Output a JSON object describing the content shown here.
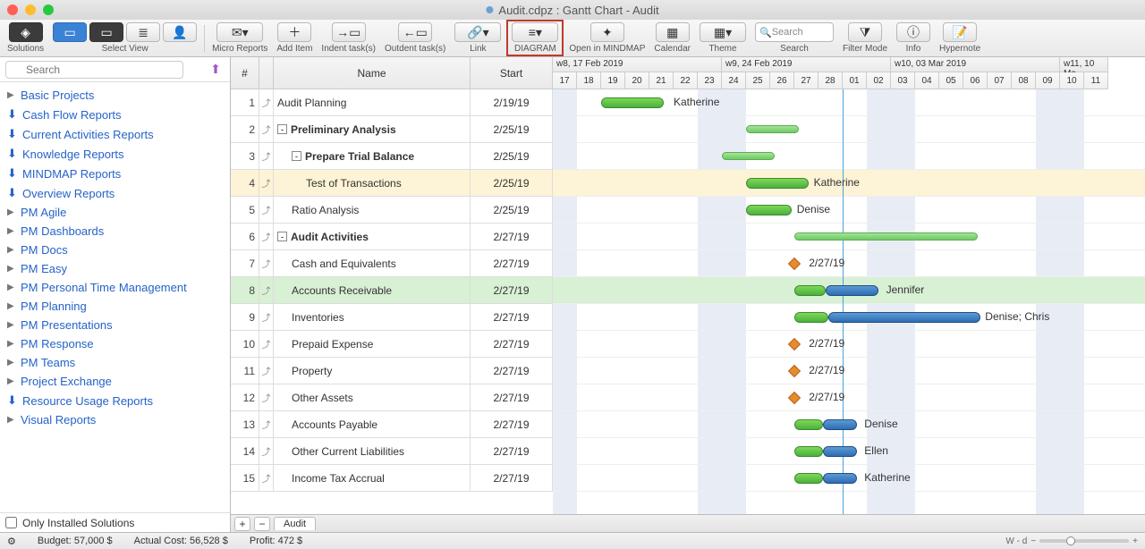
{
  "window": {
    "title": "Audit.cdpz : Gantt Chart - Audit"
  },
  "toolbar": {
    "solutions": "Solutions",
    "select_view": "Select View",
    "micro_reports": "Micro Reports",
    "add_item": "Add Item",
    "indent": "Indent task(s)",
    "outdent": "Outdent task(s)",
    "link": "Link",
    "diagram": "DIAGRAM",
    "open_mindmap": "Open in MINDMAP",
    "calendar": "Calendar",
    "theme": "Theme",
    "search": "Search",
    "search_placeholder": "Search",
    "filter_mode": "Filter Mode",
    "info": "Info",
    "hypernote": "Hypernote"
  },
  "sidebar": {
    "search_placeholder": "Search",
    "items": [
      {
        "icon": "tri",
        "label": "Basic Projects"
      },
      {
        "icon": "dl",
        "label": "Cash Flow Reports"
      },
      {
        "icon": "dl",
        "label": "Current Activities Reports"
      },
      {
        "icon": "dl",
        "label": "Knowledge Reports"
      },
      {
        "icon": "dl",
        "label": "MINDMAP Reports"
      },
      {
        "icon": "dl",
        "label": "Overview Reports"
      },
      {
        "icon": "tri",
        "label": "PM Agile"
      },
      {
        "icon": "tri",
        "label": "PM Dashboards"
      },
      {
        "icon": "tri",
        "label": "PM Docs"
      },
      {
        "icon": "tri",
        "label": "PM Easy"
      },
      {
        "icon": "tri",
        "label": "PM Personal Time Management"
      },
      {
        "icon": "tri",
        "label": "PM Planning"
      },
      {
        "icon": "tri",
        "label": "PM Presentations"
      },
      {
        "icon": "tri",
        "label": "PM Response"
      },
      {
        "icon": "tri",
        "label": "PM Teams"
      },
      {
        "icon": "tri",
        "label": "Project Exchange"
      },
      {
        "icon": "dl",
        "label": "Resource Usage Reports"
      },
      {
        "icon": "tri",
        "label": "Visual Reports"
      }
    ],
    "footer": "Only Installed Solutions"
  },
  "grid": {
    "headers": {
      "num": "#",
      "name": "Name",
      "start": "Start"
    },
    "rows": [
      {
        "n": 1,
        "name": "Audit Planning",
        "start": "2/19/19",
        "bold": false,
        "indent": 0
      },
      {
        "n": 2,
        "name": "Preliminary Analysis",
        "start": "2/25/19",
        "bold": true,
        "indent": 0,
        "exp": "-"
      },
      {
        "n": 3,
        "name": "Prepare Trial Balance",
        "start": "2/25/19",
        "bold": true,
        "indent": 1,
        "exp": "-"
      },
      {
        "n": 4,
        "name": "Test of Transactions",
        "start": "2/25/19",
        "bold": false,
        "indent": 2,
        "hl": "yellow"
      },
      {
        "n": 5,
        "name": "Ratio Analysis",
        "start": "2/25/19",
        "bold": false,
        "indent": 1
      },
      {
        "n": 6,
        "name": "Audit Activities",
        "start": "2/27/19",
        "bold": true,
        "indent": 0,
        "exp": "-"
      },
      {
        "n": 7,
        "name": "Cash and Equivalents",
        "start": "2/27/19",
        "bold": false,
        "indent": 1
      },
      {
        "n": 8,
        "name": "Accounts Receivable",
        "start": "2/27/19",
        "bold": false,
        "indent": 1,
        "hl": "green"
      },
      {
        "n": 9,
        "name": "Inventories",
        "start": "2/27/19",
        "bold": false,
        "indent": 1
      },
      {
        "n": 10,
        "name": "Prepaid Expense",
        "start": "2/27/19",
        "bold": false,
        "indent": 1
      },
      {
        "n": 11,
        "name": "Property",
        "start": "2/27/19",
        "bold": false,
        "indent": 1
      },
      {
        "n": 12,
        "name": "Other Assets",
        "start": "2/27/19",
        "bold": false,
        "indent": 1
      },
      {
        "n": 13,
        "name": "Accounts Payable",
        "start": "2/27/19",
        "bold": false,
        "indent": 1
      },
      {
        "n": 14,
        "name": "Other Current Liabilities",
        "start": "2/27/19",
        "bold": false,
        "indent": 1
      },
      {
        "n": 15,
        "name": "Income Tax  Accrual",
        "start": "2/27/19",
        "bold": false,
        "indent": 1
      }
    ]
  },
  "timeline": {
    "weeks": [
      {
        "label": "w8, 17 Feb 2019",
        "days": [
          "17",
          "18",
          "19",
          "20",
          "21",
          "22",
          "23"
        ]
      },
      {
        "label": "w9, 24 Feb 2019",
        "days": [
          "24",
          "25",
          "26",
          "27",
          "28",
          "01",
          "02"
        ]
      },
      {
        "label": "w10, 03 Mar 2019",
        "days": [
          "03",
          "04",
          "05",
          "06",
          "07",
          "08",
          "09"
        ]
      },
      {
        "label": "w11, 10 Ma",
        "days": [
          "10",
          "11"
        ]
      }
    ]
  },
  "chart_data": {
    "type": "gantt",
    "day_width": 27,
    "origin_day": "2019-02-17",
    "weekends": [
      0,
      6,
      7,
      13,
      14,
      20,
      21
    ],
    "today": 12,
    "rows": [
      {
        "bars": [
          {
            "type": "green",
            "from": 2,
            "to": 4.6
          }
        ],
        "label": {
          "text": "Katherine",
          "at": 5
        }
      },
      {
        "bars": [
          {
            "type": "greenlight",
            "from": 8,
            "to": 10.2
          }
        ]
      },
      {
        "bars": [
          {
            "type": "greenlight",
            "from": 7,
            "to": 9.2
          }
        ]
      },
      {
        "bars": [
          {
            "type": "green",
            "from": 8,
            "to": 10.6
          }
        ],
        "label": {
          "text": "Katherine",
          "at": 10.8
        },
        "hl": "yellow"
      },
      {
        "bars": [
          {
            "type": "green",
            "from": 8,
            "to": 9.9
          }
        ],
        "label": {
          "text": "Denise",
          "at": 10.1
        }
      },
      {
        "bars": [
          {
            "type": "greenlight",
            "from": 10,
            "to": 17.6
          }
        ]
      },
      {
        "diamonds": [
          10
        ],
        "label": {
          "text": "2/27/19",
          "at": 10.6
        }
      },
      {
        "bars": [
          {
            "type": "green",
            "from": 10,
            "to": 11.3
          },
          {
            "type": "bluebar",
            "from": 11.3,
            "to": 13.5
          }
        ],
        "label": {
          "text": "Jennifer",
          "at": 13.8
        },
        "hl": "green"
      },
      {
        "bars": [
          {
            "type": "green",
            "from": 10,
            "to": 11.4
          },
          {
            "type": "bluebar",
            "from": 11.4,
            "to": 17.7
          }
        ],
        "label": {
          "text": "Denise; Chris",
          "at": 17.9
        }
      },
      {
        "diamonds": [
          10
        ],
        "label": {
          "text": "2/27/19",
          "at": 10.6
        }
      },
      {
        "diamonds": [
          10
        ],
        "label": {
          "text": "2/27/19",
          "at": 10.6
        }
      },
      {
        "diamonds": [
          10
        ],
        "label": {
          "text": "2/27/19",
          "at": 10.6
        }
      },
      {
        "bars": [
          {
            "type": "green",
            "from": 10,
            "to": 11.2
          },
          {
            "type": "bluebar",
            "from": 11.2,
            "to": 12.6
          }
        ],
        "label": {
          "text": "Denise",
          "at": 12.9
        }
      },
      {
        "bars": [
          {
            "type": "green",
            "from": 10,
            "to": 11.2
          },
          {
            "type": "bluebar",
            "from": 11.2,
            "to": 12.6
          }
        ],
        "label": {
          "text": "Ellen",
          "at": 12.9
        }
      },
      {
        "bars": [
          {
            "type": "green",
            "from": 10,
            "to": 11.2
          },
          {
            "type": "bluebar",
            "from": 11.2,
            "to": 12.6
          }
        ],
        "label": {
          "text": "Katherine",
          "at": 12.9
        }
      }
    ]
  },
  "tabs": {
    "sheet": "Audit"
  },
  "status": {
    "budget": "Budget: 57,000 $",
    "actual": "Actual Cost: 56,528 $",
    "profit": "Profit: 472 $",
    "zoom": "W - d"
  }
}
